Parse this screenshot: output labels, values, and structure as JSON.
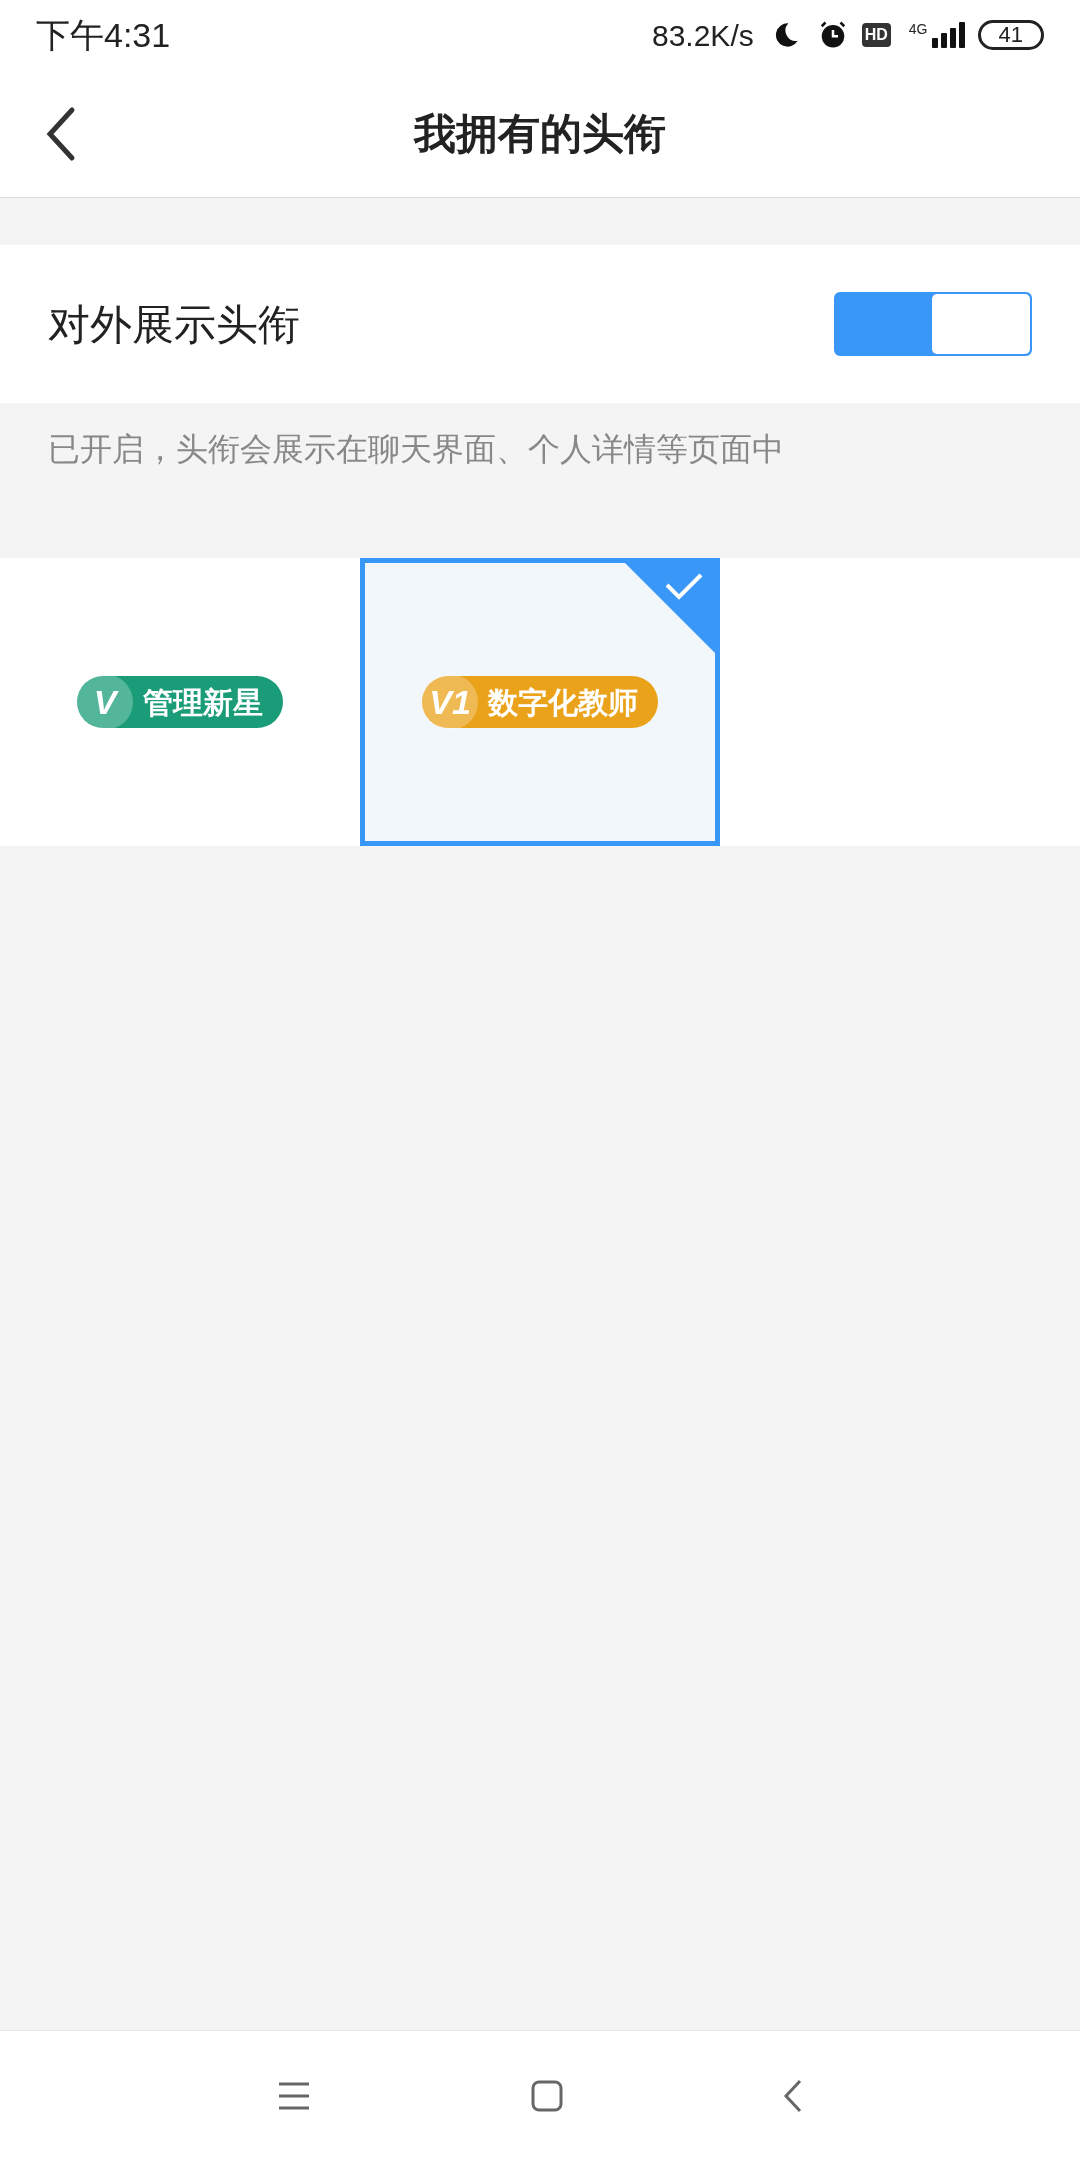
{
  "status_bar": {
    "time": "下午4:31",
    "speed": "83.2K/s",
    "network": "4G",
    "battery": "41",
    "hd": "HD"
  },
  "header": {
    "title": "我拥有的头衔"
  },
  "display_setting": {
    "label": "对外展示头衔",
    "on": true,
    "hint": "已开启，头衔会展示在聊天界面、个人详情等页面中"
  },
  "titles": [
    {
      "mark": "V",
      "label": "管理新星",
      "color": "#1a9c78",
      "selected": false
    },
    {
      "mark": "V1",
      "label": "数字化教师",
      "color": "#eaa21a",
      "selected": true
    }
  ]
}
